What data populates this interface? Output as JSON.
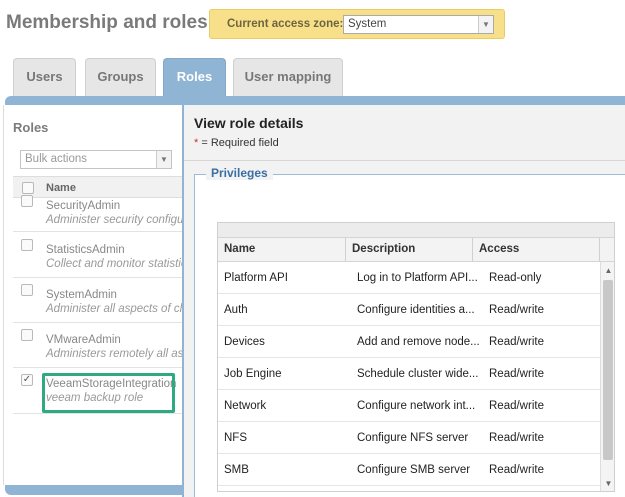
{
  "page": {
    "title": "Membership and roles"
  },
  "access_zone": {
    "label": "Current access zone:",
    "value": "System"
  },
  "tabs": [
    {
      "label": "Users"
    },
    {
      "label": "Groups"
    },
    {
      "label": "Roles",
      "active": true
    },
    {
      "label": "User mapping"
    }
  ],
  "roles_panel": {
    "title": "Roles",
    "bulk_actions_placeholder": "Bulk actions",
    "column_name": "Name",
    "roles": [
      {
        "name": "SecurityAdmin",
        "description": "Administer security configu",
        "checked": false
      },
      {
        "name": "StatisticsAdmin",
        "description": "Collect and monitor statistic",
        "checked": false
      },
      {
        "name": "SystemAdmin",
        "description": "Administer all aspects of clu",
        "checked": false
      },
      {
        "name": "VMwareAdmin",
        "description": "Administers remotely all asp",
        "checked": false
      },
      {
        "name": "VeeamStorageIntegration",
        "description": "veeam backup role",
        "checked": true
      }
    ]
  },
  "dialog": {
    "title": "View role details",
    "required_star": "*",
    "required_text": "= Required field",
    "privileges_legend": "Privileges",
    "columns": {
      "name": "Name",
      "description": "Description",
      "access": "Access"
    },
    "rows": [
      {
        "name": "Platform API",
        "description": "Log in to Platform API...",
        "access": "Read-only"
      },
      {
        "name": "Auth",
        "description": "Configure identities a...",
        "access": "Read/write"
      },
      {
        "name": "Devices",
        "description": "Add and remove node...",
        "access": "Read/write"
      },
      {
        "name": "Job Engine",
        "description": "Schedule cluster wide...",
        "access": "Read/write"
      },
      {
        "name": "Network",
        "description": "Configure network int...",
        "access": "Read/write"
      },
      {
        "name": "NFS",
        "description": "Configure NFS server",
        "access": "Read/write"
      },
      {
        "name": "SMB",
        "description": "Configure SMB server",
        "access": "Read/write"
      }
    ]
  },
  "colors": {
    "accent": "#8fb4d4",
    "highlight": "#2fa980",
    "zone_bg": "#f8e08a"
  },
  "icons": {
    "dropdown": "chevron-down-icon",
    "scroll_up": "triangle-up-icon",
    "scroll_down": "triangle-down-icon",
    "check": "check-icon"
  }
}
